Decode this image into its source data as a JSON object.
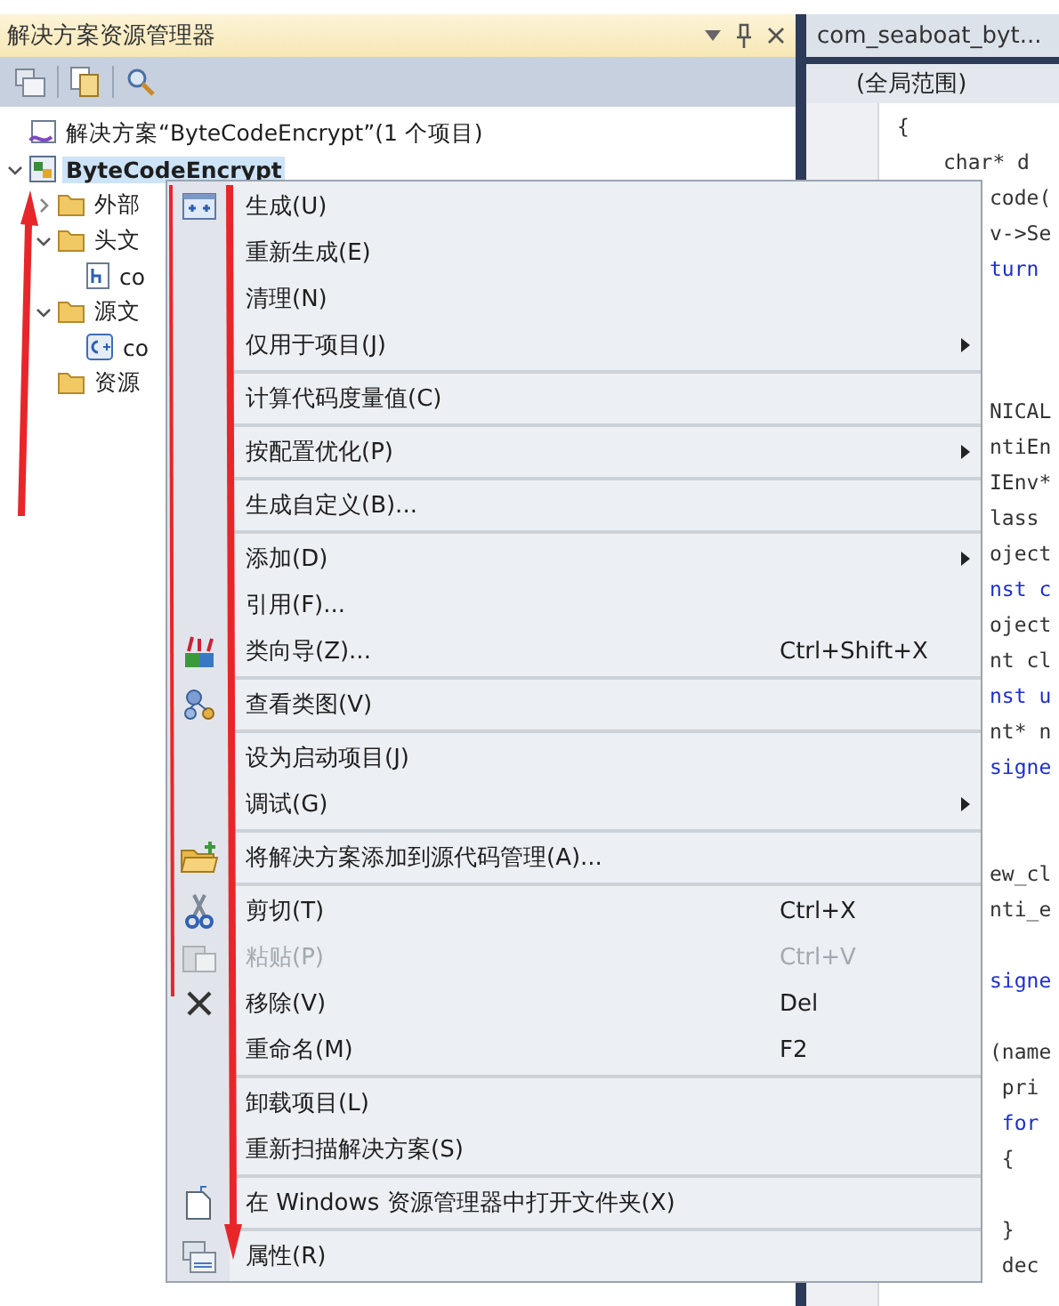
{
  "solution_explorer": {
    "title": "解决方案资源管理器",
    "tree": [
      {
        "label": "解决方案“ByteCodeEncrypt”(1 个项目)",
        "kind": "solution",
        "selected": false
      },
      {
        "label": "ByteCodeEncrypt",
        "kind": "project",
        "selected": true,
        "expanded": true,
        "children": [
          {
            "label": "外部",
            "kind": "folder",
            "selected": false,
            "expanded": false
          },
          {
            "label": "头文",
            "kind": "folder",
            "selected": false,
            "expanded": true,
            "children": [
              {
                "label": "co",
                "kind": "header",
                "selected": false
              }
            ]
          },
          {
            "label": "源文",
            "kind": "folder",
            "selected": false,
            "expanded": true,
            "children": [
              {
                "label": "co",
                "kind": "source",
                "selected": false
              }
            ]
          },
          {
            "label": "资源",
            "kind": "folder",
            "selected": false
          }
        ]
      }
    ]
  },
  "editor": {
    "tab": "com_seaboat_byt...",
    "scope": "(全局范围)",
    "code_blocks": [
      [
        {
          "text": "{",
          "kind": "plain"
        },
        {
          "text": "char* d",
          "kind": "plain"
        },
        {
          "text": "code(",
          "kind": "plain"
        },
        {
          "text": "v->Se",
          "kind": "plain"
        },
        {
          "text": "turn",
          "kind": "keyword"
        }
      ],
      [
        {
          "text": "NICAL",
          "kind": "plain"
        },
        {
          "text": "ntiEn",
          "kind": "plain"
        },
        {
          "text": "IEnv*",
          "kind": "plain"
        },
        {
          "text": "lass",
          "kind": "plain"
        },
        {
          "text": "oject",
          "kind": "plain"
        },
        {
          "text": "nst c",
          "kind": "keyword"
        },
        {
          "text": "oject",
          "kind": "plain"
        },
        {
          "text": "nt cl",
          "kind": "plain"
        },
        {
          "text": "nst u",
          "kind": "keyword"
        },
        {
          "text": "nt* n",
          "kind": "plain"
        },
        {
          "text": "signe",
          "kind": "keyword"
        }
      ],
      [
        {
          "text": "ew_cl",
          "kind": "plain"
        },
        {
          "text": "nti_e",
          "kind": "plain"
        }
      ],
      [
        {
          "text": "signe",
          "kind": "keyword"
        }
      ],
      [
        {
          "text": "(name",
          "kind": "plain"
        },
        {
          "text": " pri",
          "kind": "plain"
        },
        {
          "text": " for",
          "kind": "keyword"
        },
        {
          "text": " {",
          "kind": "plain"
        }
      ],
      [
        {
          "text": " }",
          "kind": "plain"
        },
        {
          "text": " dec",
          "kind": "plain"
        }
      ]
    ]
  },
  "context_menu": {
    "groups": [
      [
        {
          "label": "生成(U)",
          "disabled": false,
          "submenu": false
        },
        {
          "label": "重新生成(E)",
          "disabled": false,
          "submenu": false
        },
        {
          "label": "清理(N)",
          "disabled": false,
          "submenu": false
        },
        {
          "label": "仅用于项目(J)",
          "disabled": false,
          "submenu": true
        }
      ],
      [
        {
          "label": "计算代码度量值(C)",
          "disabled": false,
          "submenu": false
        }
      ],
      [
        {
          "label": "按配置优化(P)",
          "disabled": false,
          "submenu": true
        }
      ],
      [
        {
          "label": "生成自定义(B)...",
          "disabled": false,
          "submenu": false
        }
      ],
      [
        {
          "label": "添加(D)",
          "disabled": false,
          "submenu": true
        },
        {
          "label": "引用(F)...",
          "disabled": false,
          "submenu": false
        },
        {
          "label": "类向导(Z)...",
          "shortcut": "Ctrl+Shift+X",
          "disabled": false,
          "submenu": false
        }
      ],
      [
        {
          "label": "查看类图(V)",
          "disabled": false,
          "submenu": false
        }
      ],
      [
        {
          "label": "设为启动项目(J)",
          "disabled": false,
          "submenu": false
        },
        {
          "label": "调试(G)",
          "disabled": false,
          "submenu": true
        }
      ],
      [
        {
          "label": "将解决方案添加到源代码管理(A)...",
          "disabled": false,
          "submenu": false
        }
      ],
      [
        {
          "label": "剪切(T)",
          "shortcut": "Ctrl+X",
          "disabled": false,
          "submenu": false
        },
        {
          "label": "粘贴(P)",
          "shortcut": "Ctrl+V",
          "disabled": true,
          "submenu": false
        },
        {
          "label": "移除(V)",
          "shortcut": "Del",
          "disabled": false,
          "submenu": false
        },
        {
          "label": "重命名(M)",
          "shortcut": "F2",
          "disabled": false,
          "submenu": false
        }
      ],
      [
        {
          "label": "卸载项目(L)",
          "disabled": false,
          "submenu": false
        },
        {
          "label": "重新扫描解决方案(S)",
          "disabled": false,
          "submenu": false
        }
      ],
      [
        {
          "label": "在 Windows 资源管理器中打开文件夹(X)",
          "disabled": false,
          "submenu": false
        }
      ],
      [
        {
          "label": "属性(R)",
          "disabled": false,
          "submenu": false
        }
      ]
    ]
  }
}
